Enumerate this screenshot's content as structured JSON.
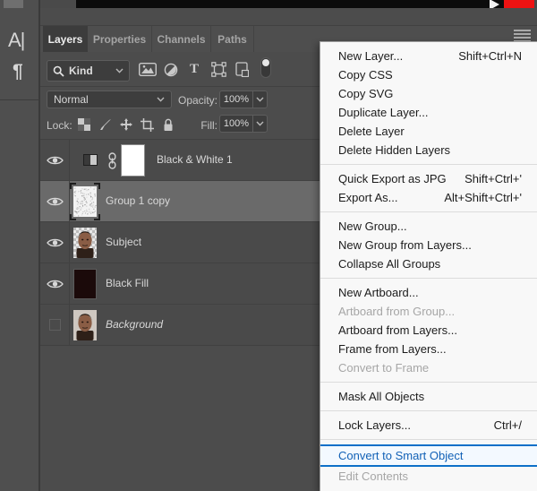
{
  "left_toolbar": {
    "icons": [
      {
        "name": "character-panel-icon",
        "glyph": "A|"
      },
      {
        "name": "paragraph-panel-icon",
        "glyph": "¶"
      }
    ]
  },
  "panel": {
    "tabs": [
      {
        "label": "Layers",
        "active": true
      },
      {
        "label": "Properties",
        "active": false
      },
      {
        "label": "Channels",
        "active": false
      },
      {
        "label": "Paths",
        "active": false
      }
    ],
    "filter": {
      "search_label": "Kind"
    },
    "blend": {
      "mode": "Normal",
      "opacity_label": "Opacity:",
      "opacity_value": "100%"
    },
    "lock": {
      "label": "Lock:",
      "fill_label": "Fill:",
      "fill_value": "100%"
    },
    "layers": [
      {
        "name": "Black & White 1",
        "type": "adjustment",
        "visible": true,
        "selected": false,
        "italic": false
      },
      {
        "name": "Group 1 copy",
        "type": "noise",
        "visible": true,
        "selected": true,
        "italic": false
      },
      {
        "name": "Subject",
        "type": "portrait",
        "visible": true,
        "selected": false,
        "italic": false
      },
      {
        "name": "Black Fill",
        "type": "black-fill",
        "visible": true,
        "selected": false,
        "italic": false
      },
      {
        "name": "Background",
        "type": "portrait-bg",
        "visible": false,
        "selected": false,
        "italic": true
      }
    ]
  },
  "menu": {
    "items": [
      {
        "label": "New Layer...",
        "shortcut": "Shift+Ctrl+N"
      },
      {
        "label": "Copy CSS"
      },
      {
        "label": "Copy SVG"
      },
      {
        "label": "Duplicate Layer..."
      },
      {
        "label": "Delete Layer"
      },
      {
        "label": "Delete Hidden Layers"
      },
      {
        "type": "separator"
      },
      {
        "label": "Quick Export as JPG",
        "shortcut": "Shift+Ctrl+'"
      },
      {
        "label": "Export As...",
        "shortcut": "Alt+Shift+Ctrl+'"
      },
      {
        "type": "separator"
      },
      {
        "label": "New Group..."
      },
      {
        "label": "New Group from Layers..."
      },
      {
        "label": "Collapse All Groups"
      },
      {
        "type": "separator"
      },
      {
        "label": "New Artboard..."
      },
      {
        "label": "Artboard from Group...",
        "disabled": true
      },
      {
        "label": "Artboard from Layers..."
      },
      {
        "label": "Frame from Layers..."
      },
      {
        "label": "Convert to Frame",
        "disabled": true
      },
      {
        "type": "separator"
      },
      {
        "label": "Mask All Objects"
      },
      {
        "type": "separator"
      },
      {
        "label": "Lock Layers...",
        "shortcut": "Ctrl+/"
      },
      {
        "type": "separator"
      },
      {
        "label": "Convert to Smart Object",
        "highlighted": true
      },
      {
        "label": "Edit Contents",
        "disabled": true
      }
    ]
  },
  "colors": {
    "panel_bg": "#4c4c4c",
    "selected_row_bg": "#6a6a6a",
    "menu_bg": "#f8f8f8",
    "highlight_border": "#0d70c8",
    "highlight_bg": "#f3f9ff",
    "highlight_text": "#1261b6",
    "video_red": "#ee1212"
  }
}
